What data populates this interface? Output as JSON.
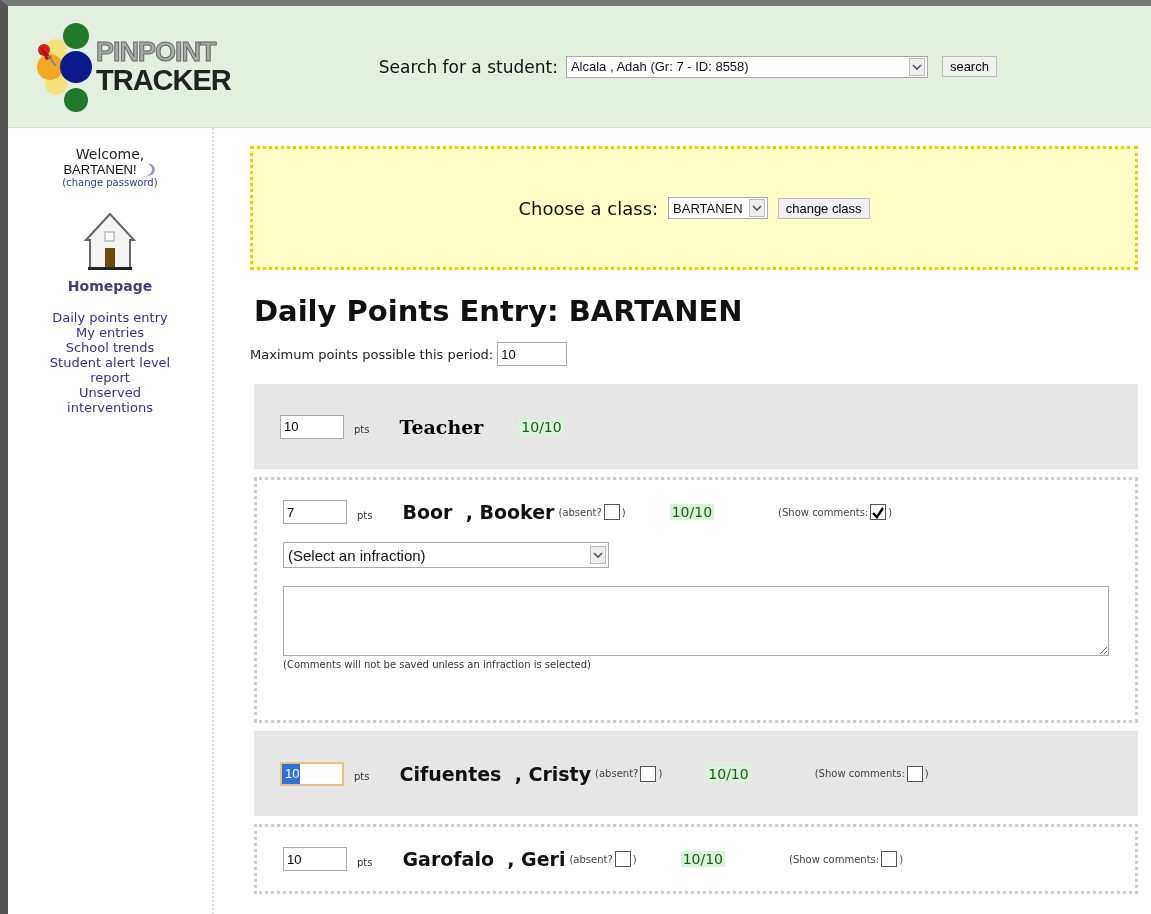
{
  "header": {
    "logo_line1": "PINPOINT",
    "logo_line2": "TRACKER",
    "search_label": "Search for a student:",
    "student_select": "Alcala  , Adah (Gr: 7 - ID: 8558)",
    "search_button": "search"
  },
  "sidebar": {
    "welcome": "Welcome,",
    "user": "BARTANEN!",
    "change_password": "(change password)",
    "home_label": "Homepage",
    "links": [
      "Daily points entry",
      "My entries",
      "School trends",
      "Student alert level report",
      "Unserved interventions"
    ]
  },
  "class_picker": {
    "label": "Choose a class:",
    "value": "BARTANEN",
    "button": "change class"
  },
  "title": "Daily Points Entry: BARTANEN",
  "max_points": {
    "label": "Maximum points possible this period:",
    "value": "10"
  },
  "rows": [
    {
      "kind": "teacher",
      "points": "10",
      "pts_label": "pts",
      "name": "Teacher",
      "score": "10/10"
    },
    {
      "kind": "student",
      "points": "7",
      "focused": false,
      "pts_label": "pts",
      "name": "Boor  , Booker",
      "absent_label": "(absent?",
      "absent": false,
      "absent_close": ")",
      "score": "10/10",
      "comments_label": "(Show comments:",
      "show_comments": true,
      "comments_close": ")",
      "infraction": "(Select an infraction)",
      "comments_note": "(Comments will not be saved unless an infraction is selected)"
    },
    {
      "kind": "student",
      "points": "10",
      "focused": true,
      "pts_label": "pts",
      "name": "Cifuentes  , Cristy",
      "absent_label": "(absent?",
      "absent": false,
      "absent_close": ")",
      "score": "10/10",
      "comments_label": "(Show comments:",
      "show_comments": false,
      "comments_close": ")"
    },
    {
      "kind": "student",
      "points": "10",
      "focused": false,
      "pts_label": "pts",
      "name": "Garofalo  , Geri",
      "absent_label": "(absent?",
      "absent": false,
      "absent_close": ")",
      "score": "10/10",
      "comments_label": "(Show comments:",
      "show_comments": false,
      "comments_close": ")"
    }
  ]
}
